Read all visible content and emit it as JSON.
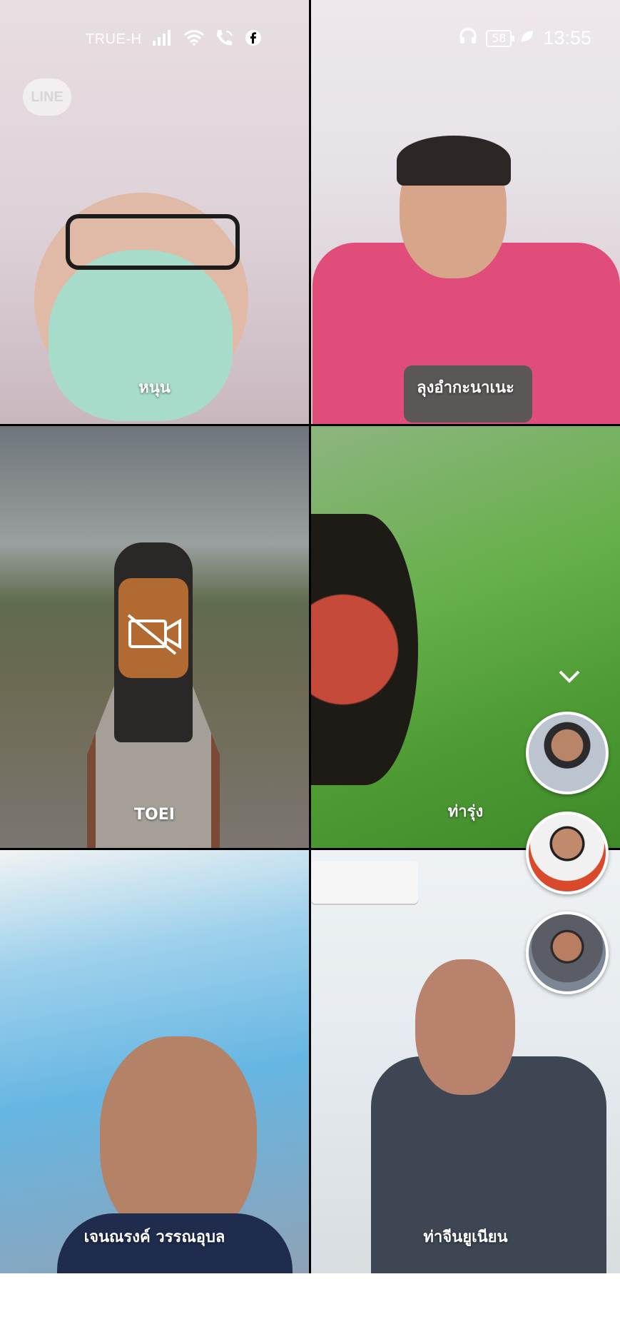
{
  "status_bar": {
    "carrier": "TRUE-H",
    "battery": "58",
    "time": "13:55"
  },
  "branding": {
    "watermark": "LINE"
  },
  "participants": [
    {
      "name": "หนุน"
    },
    {
      "name": "ลุงอำกะนาเนะ"
    },
    {
      "name": "TOEI",
      "video_off": true
    },
    {
      "name": "ท่ารุ่ง"
    },
    {
      "name": "เจนณรงค์ วรรณอุบล"
    },
    {
      "name": "ท่าจีนยูเนียน"
    }
  ],
  "more_participants": [
    {
      "icon": "avatar"
    },
    {
      "icon": "avatar"
    },
    {
      "icon": "avatar"
    }
  ],
  "icons": {
    "signal": "signal-icon",
    "wifi": "wifi-icon",
    "call": "wifi-calling-icon",
    "facebook": "facebook-icon",
    "headset": "headset-icon",
    "leaf": "leaf-icon",
    "camera_off": "video-off-icon",
    "chevron": "chevron-down-icon"
  },
  "colors": {
    "nav_background": "#ffffff",
    "text_on_video": "#ffffff"
  }
}
